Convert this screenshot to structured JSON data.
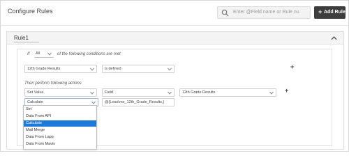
{
  "header": {
    "title": "Configure Rules",
    "search_placeholder": "Enter @Field name or Rule nu",
    "add_rule_label": "Add Rule",
    "add_rule_plus": "+"
  },
  "rule": {
    "name": "Rule1",
    "conditions_prefix": "If",
    "conditions_mode": "All",
    "conditions_suffix": "of the following conditions are met",
    "condition_field": "12th Grade Results",
    "condition_operator": "is defined",
    "actions_label": "Then perform following actions",
    "action_type": "Set Value",
    "action_target_kind": "Field",
    "action_target_field": "12th Grade Results",
    "value_source": "Calculate",
    "value_expression": "@{Lead:mx_12th_Grade_Results,}",
    "add_plus": "+"
  },
  "value_source_options": [
    {
      "label": "Set",
      "selected": false
    },
    {
      "label": "Data From API",
      "selected": false
    },
    {
      "label": "Calculate",
      "selected": true
    },
    {
      "label": "Mail Merge",
      "selected": false
    },
    {
      "label": "Data From Lapp",
      "selected": false
    },
    {
      "label": "Data From Mavis",
      "selected": false
    }
  ],
  "colors": {
    "accent": "#1e7ad8",
    "button_dark": "#3d3d3d"
  }
}
